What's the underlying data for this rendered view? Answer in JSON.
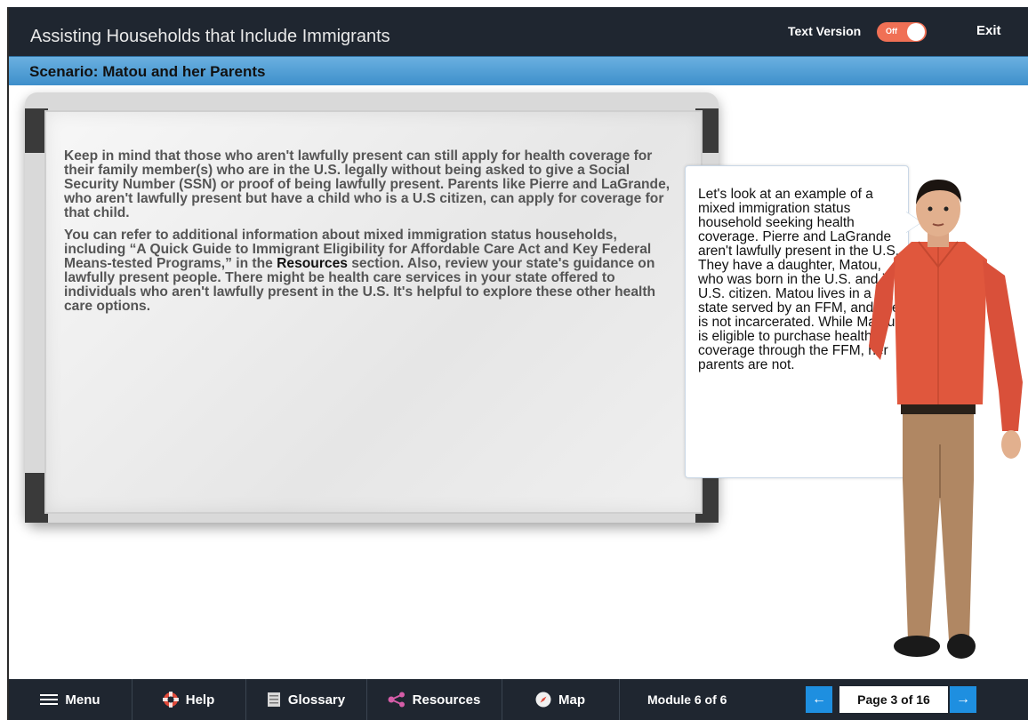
{
  "header": {
    "title": "Assisting Households that Include Immigrants",
    "text_version_label": "Text Version",
    "toggle_state": "Off",
    "exit_label": "Exit"
  },
  "subheader": {
    "title": "Scenario: Matou and her Parents"
  },
  "board": {
    "paragraph1": "Keep in mind that those who aren't lawfully present can still apply for health coverage for their family member(s) who are in the U.S. legally without being asked to give a Social Security Number (SSN) or proof of being lawfully present. Parents like Pierre and LaGrande, who aren't lawfully present but have a child who is a U.S citizen, can apply for coverage for that child.",
    "paragraph2_before": "You can refer to additional information about mixed immigration status households, including “A Quick Guide to Immigrant Eligibility for Affordable Care Act and Key Federal Means-tested Programs,” in the ",
    "paragraph2_link": "Resources",
    "paragraph2_after": " section. Also, review your state's guidance on lawfully present people. There might be health care services in your state offered to individuals who aren't lawfully present in the U.S. It's helpful to explore these other health care options."
  },
  "bubble": {
    "text": "Let's look at an example of a mixed immigration status household seeking health coverage. Pierre and LaGrande aren't lawfully present in the U.S. They have a daughter, Matou, who was born in the U.S. and is a U.S. citizen. Matou lives in a state served by an FFM, and she is not incarcerated. While Matou is eligible to purchase health coverage through the FFM, her parents are not."
  },
  "footer": {
    "menu": "Menu",
    "help": "Help",
    "glossary": "Glossary",
    "resources": "Resources",
    "map": "Map",
    "module": "Module 6 of 6",
    "page": "Page 3 of 16",
    "prev_icon": "arrow-left-icon",
    "next_icon": "arrow-right-icon"
  },
  "colors": {
    "header_bg": "#1f2630",
    "subheader_bg": "#4a9ad4",
    "toggle": "#f07055",
    "nav_arrow": "#1e8fe0"
  }
}
